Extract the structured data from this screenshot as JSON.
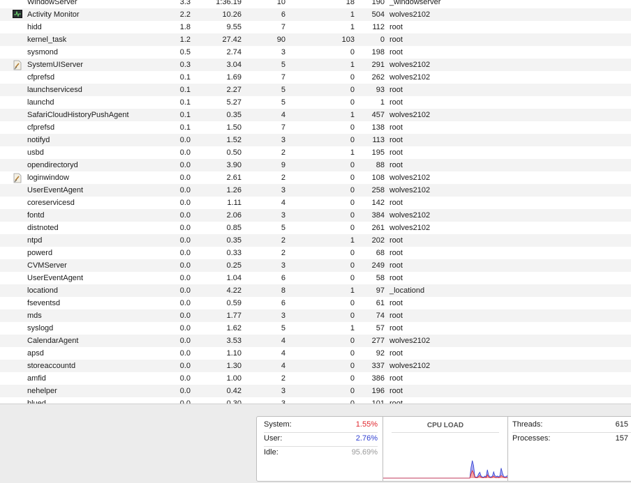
{
  "processes": [
    {
      "name": "WindowServer",
      "cpu": "3.3",
      "time": "1:36.19",
      "threads": "10",
      "ports": "18",
      "pid": "190",
      "user": "_windowserver",
      "icon": ""
    },
    {
      "name": "Activity Monitor",
      "cpu": "2.2",
      "time": "10.26",
      "threads": "6",
      "ports": "1",
      "pid": "504",
      "user": "wolves2102",
      "icon": "activity-monitor-icon"
    },
    {
      "name": "hidd",
      "cpu": "1.8",
      "time": "9.55",
      "threads": "7",
      "ports": "1",
      "pid": "112",
      "user": "root",
      "icon": ""
    },
    {
      "name": "kernel_task",
      "cpu": "1.2",
      "time": "27.42",
      "threads": "90",
      "ports": "103",
      "pid": "0",
      "user": "root",
      "icon": ""
    },
    {
      "name": "sysmond",
      "cpu": "0.5",
      "time": "2.74",
      "threads": "3",
      "ports": "0",
      "pid": "198",
      "user": "root",
      "icon": ""
    },
    {
      "name": "SystemUIServer",
      "cpu": "0.3",
      "time": "3.04",
      "threads": "5",
      "ports": "1",
      "pid": "291",
      "user": "wolves2102",
      "icon": "application-document-icon"
    },
    {
      "name": "cfprefsd",
      "cpu": "0.1",
      "time": "1.69",
      "threads": "7",
      "ports": "0",
      "pid": "262",
      "user": "wolves2102",
      "icon": ""
    },
    {
      "name": "launchservicesd",
      "cpu": "0.1",
      "time": "2.27",
      "threads": "5",
      "ports": "0",
      "pid": "93",
      "user": "root",
      "icon": ""
    },
    {
      "name": "launchd",
      "cpu": "0.1",
      "time": "5.27",
      "threads": "5",
      "ports": "0",
      "pid": "1",
      "user": "root",
      "icon": ""
    },
    {
      "name": "SafariCloudHistoryPushAgent",
      "cpu": "0.1",
      "time": "0.35",
      "threads": "4",
      "ports": "1",
      "pid": "457",
      "user": "wolves2102",
      "icon": ""
    },
    {
      "name": "cfprefsd",
      "cpu": "0.1",
      "time": "1.50",
      "threads": "7",
      "ports": "0",
      "pid": "138",
      "user": "root",
      "icon": ""
    },
    {
      "name": "notifyd",
      "cpu": "0.0",
      "time": "1.52",
      "threads": "3",
      "ports": "0",
      "pid": "113",
      "user": "root",
      "icon": ""
    },
    {
      "name": "usbd",
      "cpu": "0.0",
      "time": "0.50",
      "threads": "2",
      "ports": "1",
      "pid": "195",
      "user": "root",
      "icon": ""
    },
    {
      "name": "opendirectoryd",
      "cpu": "0.0",
      "time": "3.90",
      "threads": "9",
      "ports": "0",
      "pid": "88",
      "user": "root",
      "icon": ""
    },
    {
      "name": "loginwindow",
      "cpu": "0.0",
      "time": "2.61",
      "threads": "2",
      "ports": "0",
      "pid": "108",
      "user": "wolves2102",
      "icon": "application-document-icon"
    },
    {
      "name": "UserEventAgent",
      "cpu": "0.0",
      "time": "1.26",
      "threads": "3",
      "ports": "0",
      "pid": "258",
      "user": "wolves2102",
      "icon": ""
    },
    {
      "name": "coreservicesd",
      "cpu": "0.0",
      "time": "1.11",
      "threads": "4",
      "ports": "0",
      "pid": "142",
      "user": "root",
      "icon": ""
    },
    {
      "name": "fontd",
      "cpu": "0.0",
      "time": "2.06",
      "threads": "3",
      "ports": "0",
      "pid": "384",
      "user": "wolves2102",
      "icon": ""
    },
    {
      "name": "distnoted",
      "cpu": "0.0",
      "time": "0.85",
      "threads": "5",
      "ports": "0",
      "pid": "261",
      "user": "wolves2102",
      "icon": ""
    },
    {
      "name": "ntpd",
      "cpu": "0.0",
      "time": "0.35",
      "threads": "2",
      "ports": "1",
      "pid": "202",
      "user": "root",
      "icon": ""
    },
    {
      "name": "powerd",
      "cpu": "0.0",
      "time": "0.33",
      "threads": "2",
      "ports": "0",
      "pid": "68",
      "user": "root",
      "icon": ""
    },
    {
      "name": "CVMServer",
      "cpu": "0.0",
      "time": "0.25",
      "threads": "3",
      "ports": "0",
      "pid": "249",
      "user": "root",
      "icon": ""
    },
    {
      "name": "UserEventAgent",
      "cpu": "0.0",
      "time": "1.04",
      "threads": "6",
      "ports": "0",
      "pid": "58",
      "user": "root",
      "icon": ""
    },
    {
      "name": "locationd",
      "cpu": "0.0",
      "time": "4.22",
      "threads": "8",
      "ports": "1",
      "pid": "97",
      "user": "_locationd",
      "icon": ""
    },
    {
      "name": "fseventsd",
      "cpu": "0.0",
      "time": "0.59",
      "threads": "6",
      "ports": "0",
      "pid": "61",
      "user": "root",
      "icon": ""
    },
    {
      "name": "mds",
      "cpu": "0.0",
      "time": "1.77",
      "threads": "3",
      "ports": "0",
      "pid": "74",
      "user": "root",
      "icon": ""
    },
    {
      "name": "syslogd",
      "cpu": "0.0",
      "time": "1.62",
      "threads": "5",
      "ports": "1",
      "pid": "57",
      "user": "root",
      "icon": ""
    },
    {
      "name": "CalendarAgent",
      "cpu": "0.0",
      "time": "3.53",
      "threads": "4",
      "ports": "0",
      "pid": "277",
      "user": "wolves2102",
      "icon": ""
    },
    {
      "name": "apsd",
      "cpu": "0.0",
      "time": "1.10",
      "threads": "4",
      "ports": "0",
      "pid": "92",
      "user": "root",
      "icon": ""
    },
    {
      "name": "storeaccountd",
      "cpu": "0.0",
      "time": "1.30",
      "threads": "4",
      "ports": "0",
      "pid": "337",
      "user": "wolves2102",
      "icon": ""
    },
    {
      "name": "amfid",
      "cpu": "0.0",
      "time": "1.00",
      "threads": "2",
      "ports": "0",
      "pid": "386",
      "user": "root",
      "icon": ""
    },
    {
      "name": "nehelper",
      "cpu": "0.0",
      "time": "0.42",
      "threads": "3",
      "ports": "0",
      "pid": "196",
      "user": "root",
      "icon": ""
    },
    {
      "name": "blued",
      "cpu": "0.0",
      "time": "0.30",
      "threads": "3",
      "ports": "0",
      "pid": "101",
      "user": "root",
      "icon": ""
    }
  ],
  "stats": {
    "system_label": "System:",
    "system_value": "1.55%",
    "user_label": "User:",
    "user_value": "2.76%",
    "idle_label": "Idle:",
    "idle_value": "95.69%"
  },
  "cpu_load": {
    "title": "CPU LOAD",
    "system_percent": [
      0,
      0,
      0,
      0,
      0,
      0,
      0,
      0,
      0,
      0,
      0,
      0,
      0,
      0,
      0,
      0,
      0,
      0,
      0,
      0,
      0,
      0,
      0,
      0,
      0,
      0,
      0,
      0,
      0,
      0,
      0,
      0,
      0,
      0,
      0,
      0,
      0,
      0,
      0,
      0,
      0,
      0,
      0,
      0,
      0,
      0,
      0,
      0,
      0,
      0,
      0,
      0,
      0,
      0,
      0,
      0,
      0,
      0,
      0,
      0,
      0,
      0,
      0,
      0,
      0,
      0,
      0,
      0,
      0,
      0,
      10,
      18,
      12,
      2,
      1,
      1,
      4,
      6,
      2,
      1,
      1,
      2,
      1,
      8,
      3,
      1,
      1,
      2,
      5,
      2,
      1,
      2,
      1,
      2,
      6,
      4,
      2,
      1,
      1,
      2
    ],
    "total_percent": [
      0,
      0,
      0,
      0,
      0,
      0,
      0,
      0,
      0,
      0,
      0,
      0,
      0,
      0,
      0,
      0,
      0,
      0,
      0,
      0,
      0,
      0,
      0,
      0,
      0,
      0,
      0,
      0,
      0,
      0,
      0,
      0,
      0,
      0,
      0,
      0,
      0,
      0,
      0,
      0,
      0,
      0,
      0,
      0,
      0,
      0,
      0,
      0,
      0,
      0,
      0,
      0,
      0,
      0,
      0,
      0,
      0,
      0,
      0,
      0,
      0,
      0,
      0,
      0,
      0,
      0,
      0,
      0,
      0,
      0,
      26,
      42,
      30,
      4,
      2,
      3,
      10,
      14,
      5,
      3,
      2,
      5,
      3,
      20,
      7,
      3,
      3,
      5,
      15,
      6,
      4,
      5,
      3,
      6,
      24,
      12,
      4,
      3,
      4,
      6
    ],
    "system_color": "#e0262d",
    "user_color": "#2f3fd1"
  },
  "counts": {
    "threads_label": "Threads:",
    "threads_value": "615",
    "processes_label": "Processes:",
    "processes_value": "157"
  },
  "colors": {
    "system": "#e0262d",
    "user": "#2f3fd1",
    "idle": "#9a9a9a"
  }
}
